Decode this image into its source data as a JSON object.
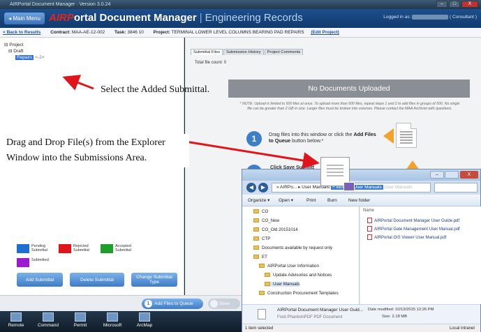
{
  "window": {
    "title": "AIRPortal Document Manager · Version 3.0.24",
    "minimize": "–",
    "maximize": "□",
    "close": "X"
  },
  "header": {
    "main_menu": "◂ Main Menu",
    "logo_prefix": "AIRP",
    "logo_rest": "ortal Document Manager",
    "separator": "|",
    "subtitle": "Engineering Records",
    "logged_in_prefix": "Logged in as:",
    "logged_in_role": "( Consultant )"
  },
  "info_bar": {
    "back_link": "< Back to Results",
    "contract_label": "Contract:",
    "contract_value": "MAA-AE-12-002",
    "task_label": "Task:",
    "task_value": "3846 10",
    "project_label": "Project:",
    "project_value": "TERMINAL LOWER LEVEL COLUMNS BEARING PAD REPAIRS",
    "edit_project": "(Edit Project)"
  },
  "tree": {
    "root": "⊟ Project",
    "child": "⊟ Draft",
    "selected": "Repairs",
    "selected_suffix": "<-2>"
  },
  "legend": {
    "items": [
      {
        "label": "Pending Submittal",
        "color": "#1f6fd0"
      },
      {
        "label": "Rejected Submittal",
        "color": "#e0151b"
      },
      {
        "label": "Accepted Submittal",
        "color": "#1f9e2c"
      },
      {
        "label": "Submitted",
        "color": "#9b1ccf"
      }
    ]
  },
  "left_buttons": {
    "add": "Add Submittal",
    "delete": "Delete Submittal",
    "change": "Change Submittal Type"
  },
  "bottom_bar": {
    "add_files": "Add Files to Queue",
    "save": "Save"
  },
  "right_panel": {
    "tabs": [
      "Submittal Files",
      "Submission History",
      "Project Comments"
    ],
    "file_count": "Total file count: 0",
    "no_docs": "No Documents Uploaded",
    "note": "NOTE: Upload is limited to 500 files at once. To upload more than 500 files, repeat steps 1 and 2 to add files in groups of 500. No single file can be greater than 2 GB in size. Larger files must be broken into volumes. Please contact the MAA Archivist with questions.",
    "note_star": "*",
    "step1_number": "1",
    "step1_text_a": "Drag files into this window or click the",
    "step1_text_b": "Add Files to Queue",
    "step1_text_c": "button below.*",
    "step2_text": "Click Save Submitt"
  },
  "explorer": {
    "nav_back": "◀",
    "nav_fwd": "▶",
    "addr_prefix": "« AIRPo... ▸ User Manuals",
    "move_to": "+ Move to User Manuals",
    "addr_ghost": "User Manuals",
    "toolbar": [
      "Organize ▾",
      "Open ▾",
      "Print",
      "Burn",
      "New folder"
    ],
    "folders": [
      {
        "name": "CO",
        "indent": 0
      },
      {
        "name": "CO_New",
        "indent": 0
      },
      {
        "name": "CO_Old 20151014",
        "indent": 0
      },
      {
        "name": "CTP",
        "indent": 0
      },
      {
        "name": "Documents available by request only",
        "indent": 0
      },
      {
        "name": "ET",
        "indent": 0
      },
      {
        "name": "AIRPortal User Information",
        "indent": 1
      },
      {
        "name": "Update Advisories and Notices",
        "indent": 2
      },
      {
        "name": "User Manuals",
        "indent": 2,
        "selected": true
      },
      {
        "name": "Construction Procurement Templates",
        "indent": 1
      }
    ],
    "file_header": "Name",
    "files": [
      "AIRPortal Document Manager User Guide.pdf",
      "AIRPortal Gate Management User Manual.pdf",
      "AIRPortal GIS Viewer User Manual.pdf"
    ],
    "details": {
      "name": "AIRPortal Document Manager User Guid...",
      "type": "Foxit PhantomPDF PDF Document",
      "modified_label": "Date modified:",
      "modified_value": "10/13/2015 12:26 PM",
      "size_label": "Size:",
      "size_value": "2.18 MB"
    },
    "status_left": "1 item selected",
    "status_right": "Local intranet"
  },
  "taskbar": [
    "Remote",
    "Command",
    "Permit",
    "Microsoft",
    "ArcMap"
  ],
  "annotations": {
    "select": "Select the Added Submittal.",
    "drag": "Drag and Drop File(s) from the Explorer Window into the Submissions Area."
  }
}
